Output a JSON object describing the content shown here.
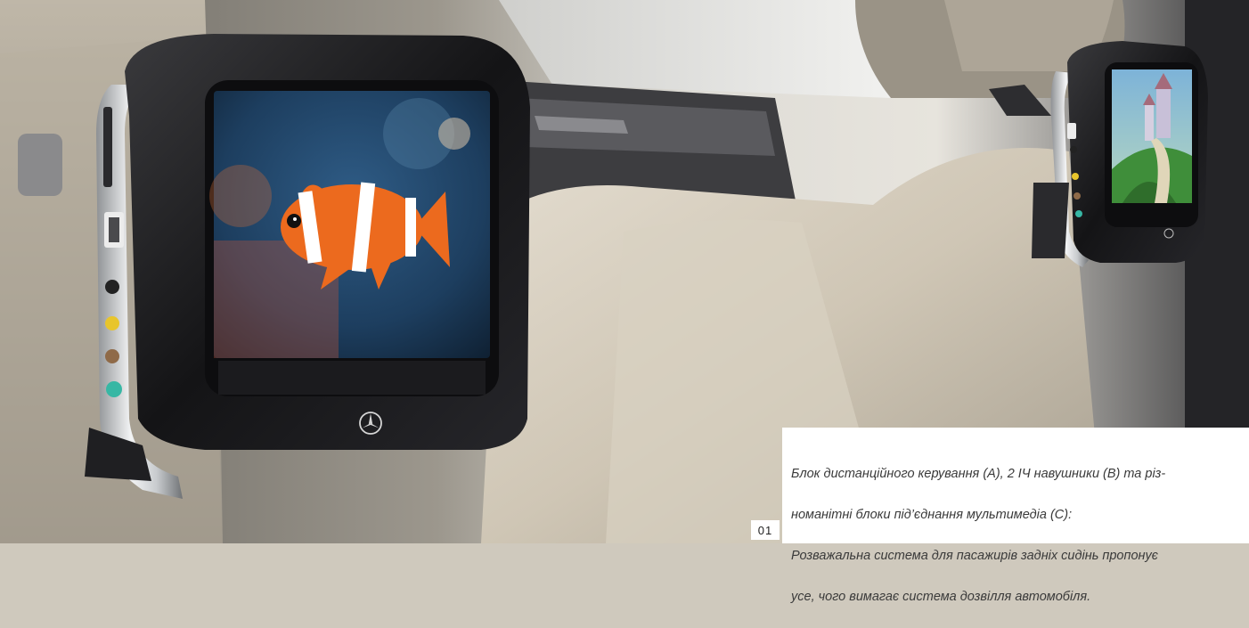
{
  "photo": {
    "subject": "rear-seat-entertainment-screens",
    "left_screen_content": "clownfish",
    "right_screen_content": "fairytale-castle",
    "logo": "mercedes-star-icon"
  },
  "badge": {
    "number": "01"
  },
  "caption": {
    "line1": "Блок дистанційного керування (A), 2 ІЧ навушники (B) та різ-",
    "line2": "номанітні блоки під’єднання мультимедіа (C):",
    "line3": "Розважальна система для пасажирів задніх сидінь пропонує",
    "line4": "усе, чого вимагає система дозвілля автомобіля."
  },
  "colors": {
    "leather": "#d8d0c1",
    "shell": "#1a1a1c",
    "chrome": "#cfd2d4",
    "caption_bg": "#ffffff",
    "caption_text": "#3a3a3a"
  }
}
